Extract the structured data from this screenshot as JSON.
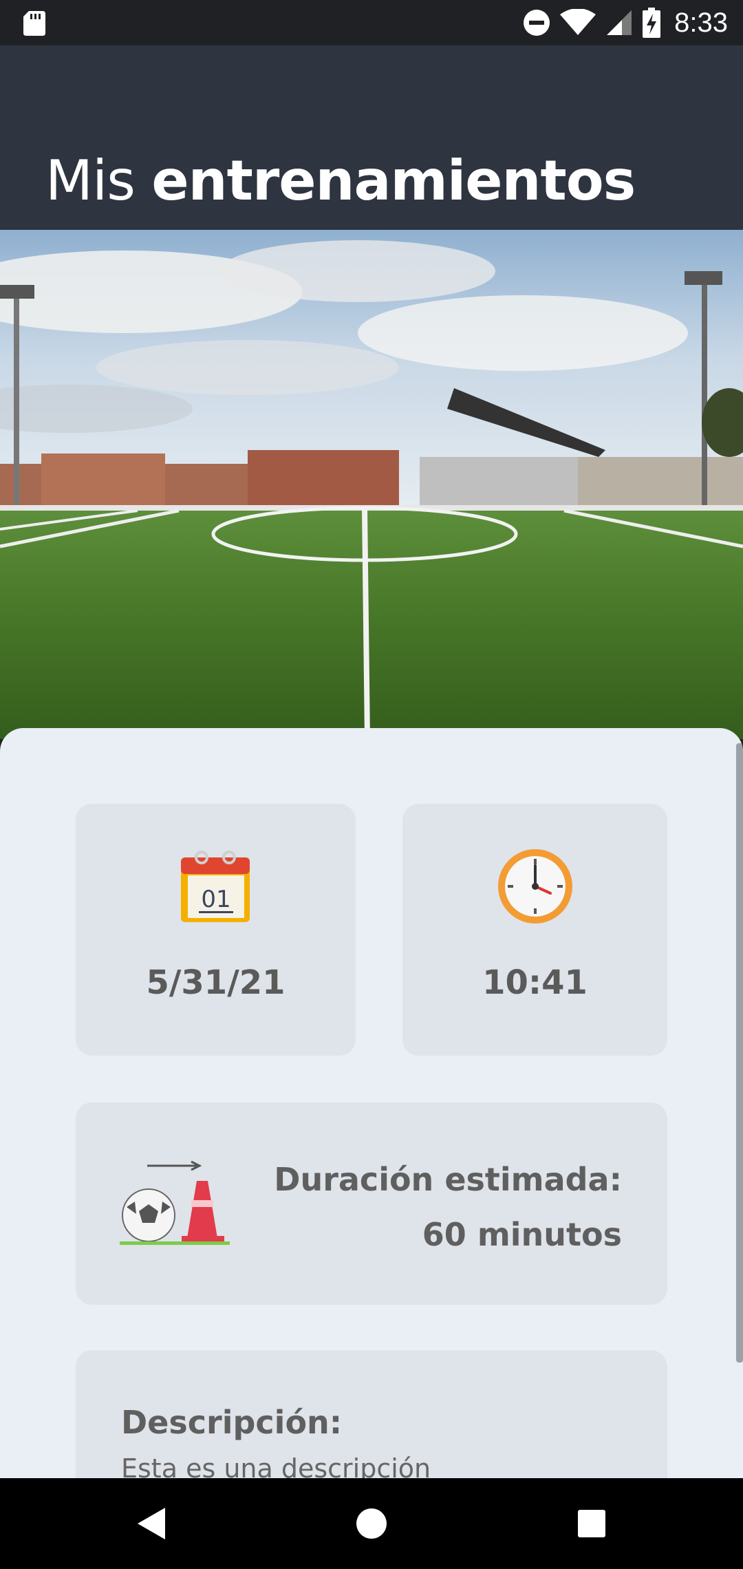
{
  "status_bar": {
    "time": "8:33",
    "icons": [
      "sd-card-icon",
      "do-not-disturb-icon",
      "wifi-icon",
      "signal-icon",
      "battery-charging-icon"
    ]
  },
  "header": {
    "title_light": "Mis",
    "title_bold": "entrenamientos"
  },
  "hero": {
    "image": "football-pitch-photo"
  },
  "cards": {
    "date": {
      "icon": "calendar-icon",
      "calendar_day": "01",
      "value": "5/31/21"
    },
    "time": {
      "icon": "clock-icon",
      "value": "10:41"
    },
    "duration": {
      "icon": "soccer-ball-cone-icon",
      "label": "Duración estimada:",
      "value": "60 minutos"
    },
    "description": {
      "label": "Descripción:",
      "text": "Esta es una descripción"
    }
  },
  "nav_bar": {
    "icons": [
      "back-icon",
      "home-icon",
      "recents-icon"
    ]
  },
  "colors": {
    "header_bg": "#2e3440",
    "sheet_bg": "#eaeef5",
    "card_bg": "#dfe3ea",
    "text": "#5a5a5a"
  }
}
